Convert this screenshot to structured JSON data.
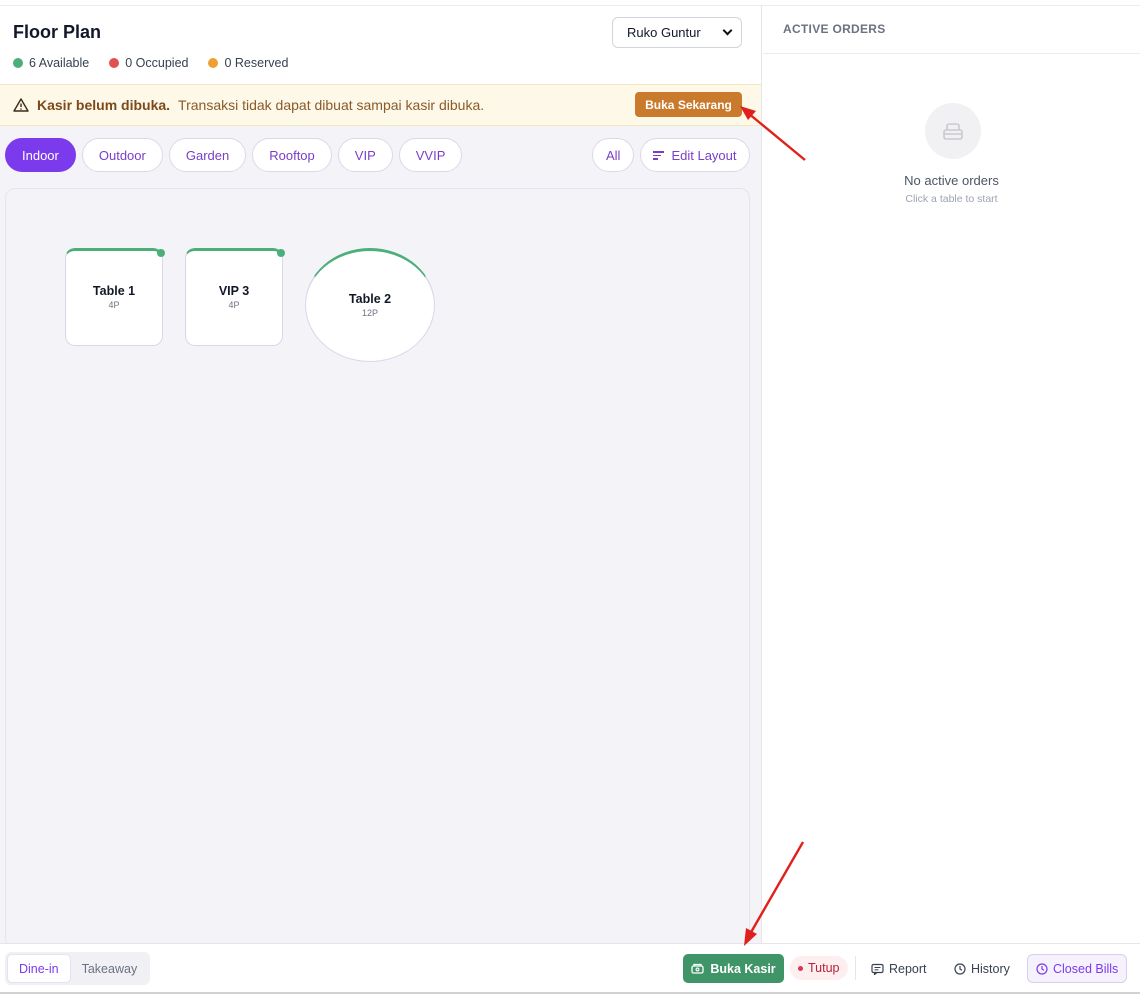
{
  "header": {
    "title": "Floor Plan",
    "location": "Ruko Guntur",
    "legend": [
      {
        "label": "6 Available",
        "color": "#4caf7a"
      },
      {
        "label": "0 Occupied",
        "color": "#e05252"
      },
      {
        "label": "0 Reserved",
        "color": "#f0a030"
      }
    ]
  },
  "alert": {
    "title": "Kasir belum dibuka.",
    "message": "Transaksi tidak dapat dibuat sampai kasir dibuka.",
    "action": "Buka Sekarang"
  },
  "areas": [
    "Indoor",
    "Outdoor",
    "Garden",
    "Rooftop",
    "VIP",
    "VVIP"
  ],
  "active_area": "Indoor",
  "filters": {
    "all": "All",
    "edit_layout": "Edit Layout"
  },
  "tables": [
    {
      "name": "Table 1",
      "capacity": "4P",
      "status": "available"
    },
    {
      "name": "VIP 3",
      "capacity": "4P",
      "status": "available"
    },
    {
      "name": "Table 2",
      "capacity": "12P",
      "status": "available"
    }
  ],
  "active_orders": {
    "heading": "ACTIVE ORDERS",
    "empty_title": "No active orders",
    "empty_sub": "Click a table to start"
  },
  "bottom": {
    "modes": [
      "Dine-in",
      "Takeaway"
    ],
    "open_cashier": "Buka Kasir",
    "cashier_status": "Tutup",
    "report": "Report",
    "history": "History",
    "closed_bills": "Closed Bills"
  },
  "colors": {
    "accent": "#7c3aed",
    "success": "#3f9468",
    "warning": "#c97a2c",
    "danger": "#d9364f"
  },
  "icons": [
    "warning-icon",
    "edit-layout-icon",
    "empty-orders-icon",
    "cash-register-icon",
    "report-icon",
    "history-icon",
    "clock-icon",
    "arrow-annotation"
  ]
}
